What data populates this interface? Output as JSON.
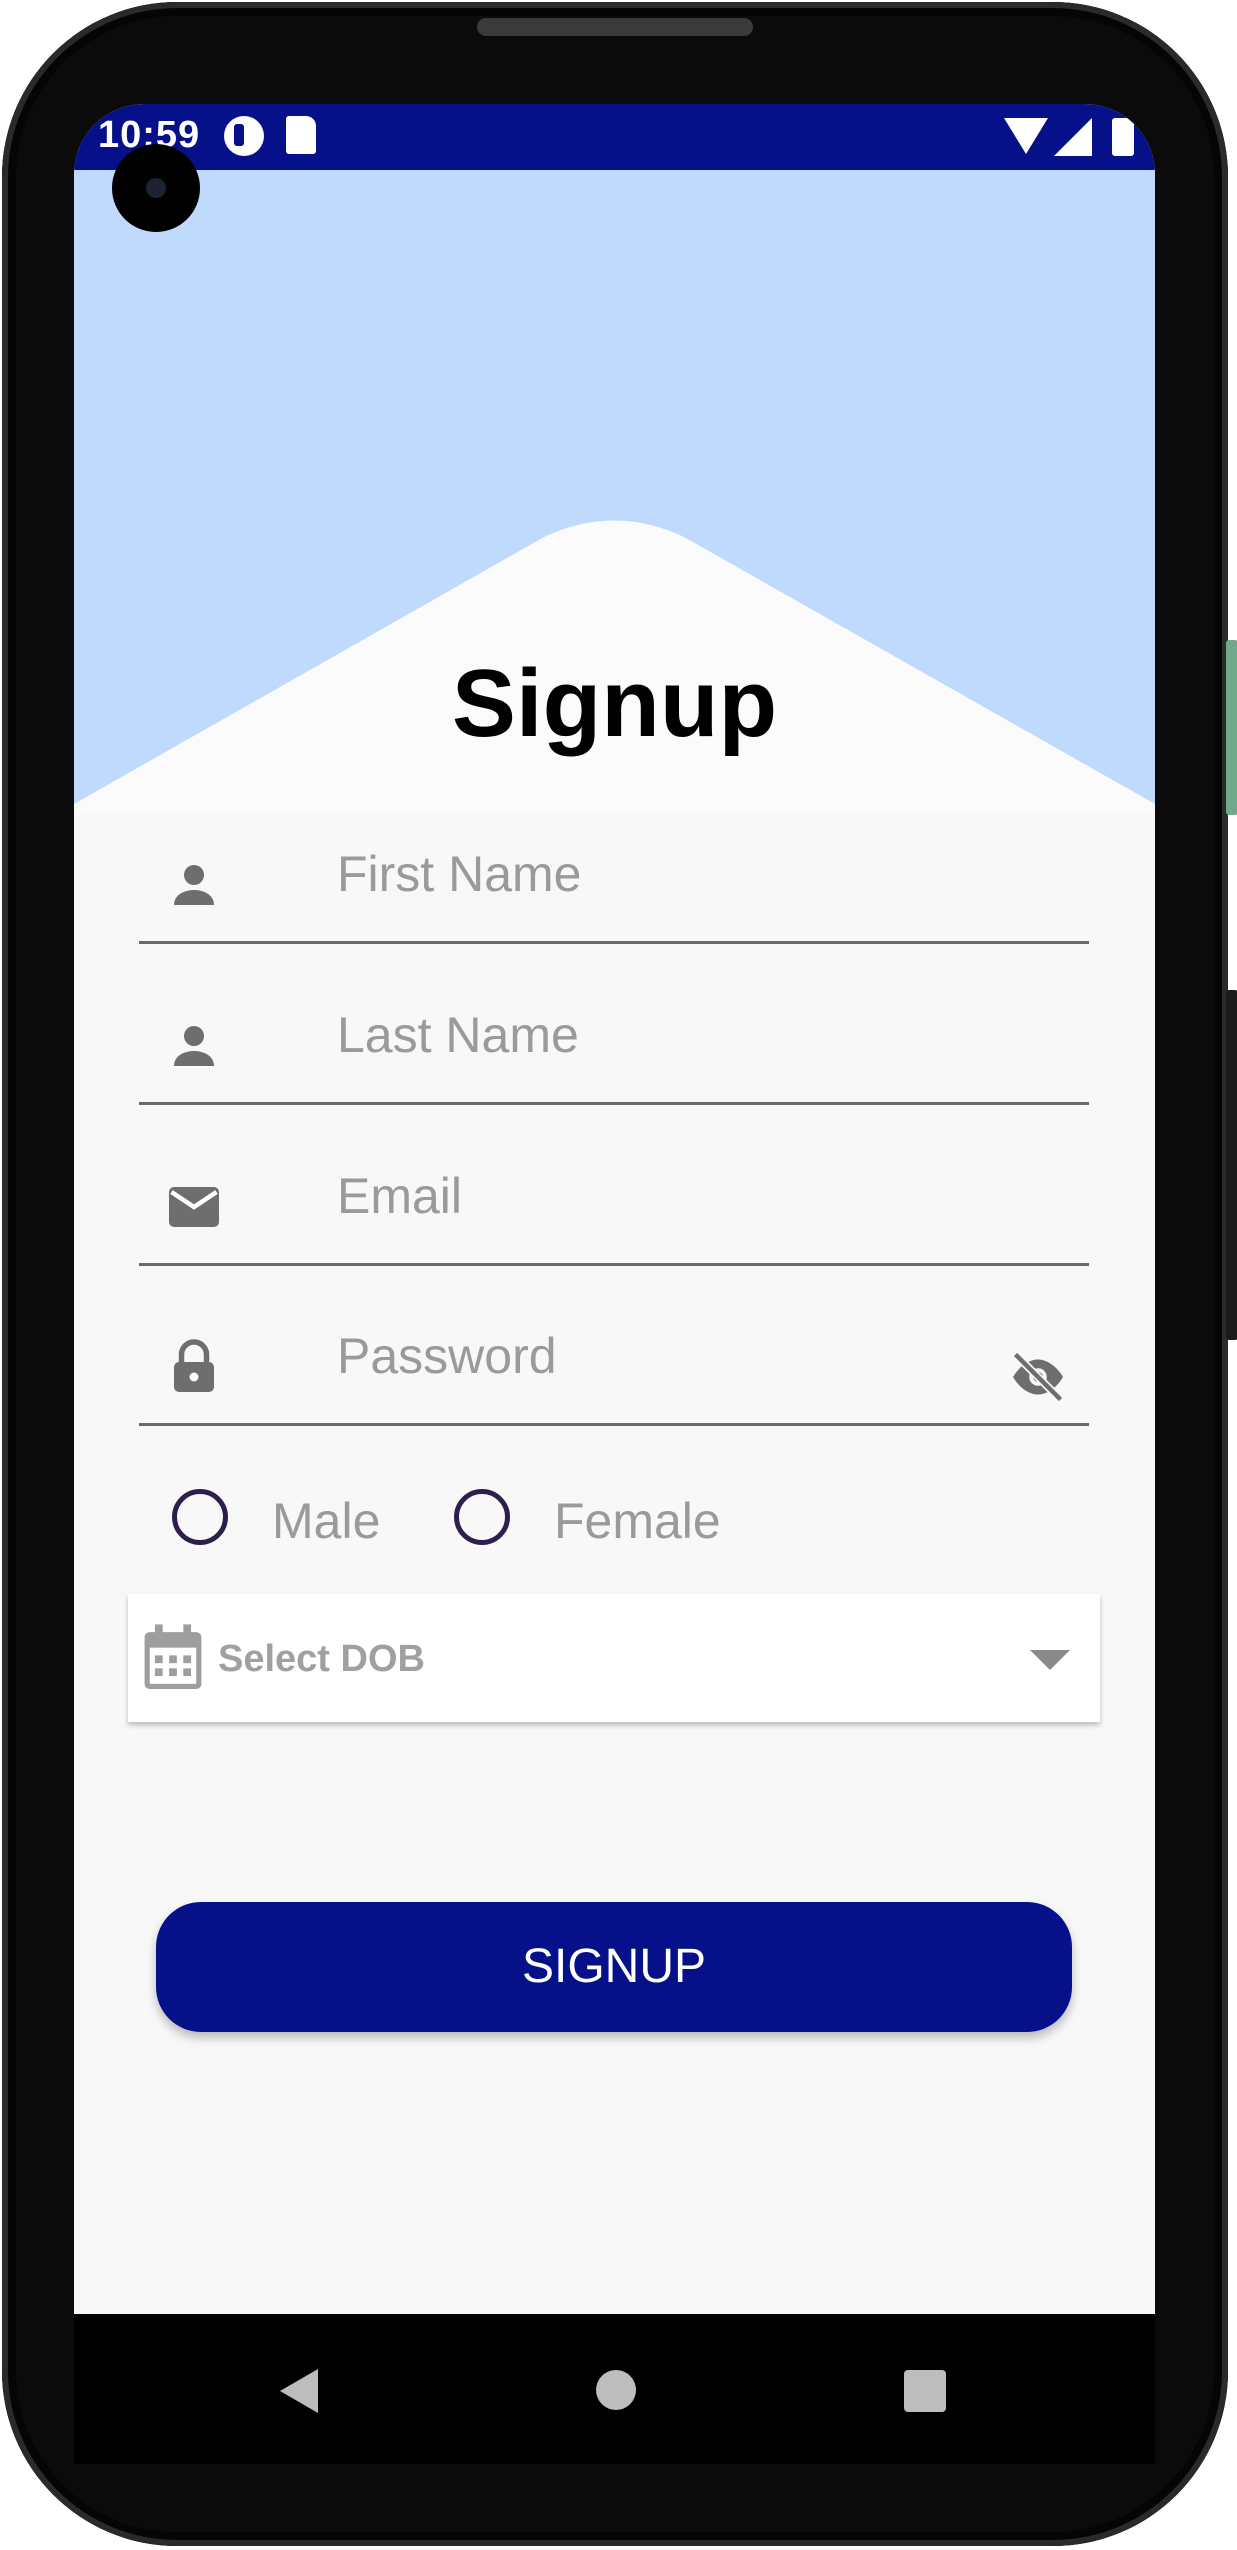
{
  "status_bar": {
    "time": "10:59",
    "icons": [
      "app-notification-icon",
      "sd-card-icon",
      "wifi-icon",
      "signal-icon",
      "battery-icon"
    ]
  },
  "header": {
    "title": "Signup",
    "background_color": "#bfdafc"
  },
  "form": {
    "first_name": {
      "placeholder": "First Name",
      "icon": "person-icon"
    },
    "last_name": {
      "placeholder": "Last Name",
      "icon": "person-icon"
    },
    "email": {
      "placeholder": "Email",
      "icon": "mail-icon"
    },
    "password": {
      "placeholder": "Password",
      "icon": "lock-icon",
      "toggle_icon": "eye-off-icon"
    },
    "gender": {
      "options": [
        "Male",
        "Female"
      ],
      "selected": null
    },
    "dob": {
      "label": "Select DOB",
      "icon": "calendar-icon"
    },
    "submit_label": "SIGNUP"
  },
  "colors": {
    "primary": "#061189",
    "hint": "#9a9a9a",
    "radio": "#2e1e4d"
  },
  "nav_bar": {
    "icons": [
      "back-icon",
      "home-icon",
      "recents-icon"
    ]
  }
}
